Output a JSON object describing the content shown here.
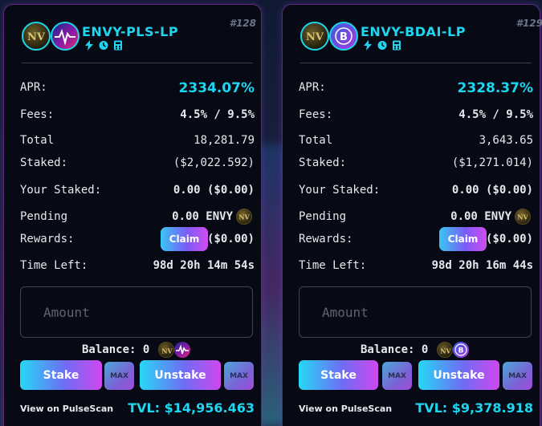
{
  "pools": [
    {
      "pool_number": "#128",
      "pair_name": "ENVY-PLS-LP",
      "token_b_icon": "pulse-wave-icon",
      "apr_label": "APR:",
      "apr_value": "2334.07%",
      "fees_label": "Fees:",
      "fees_value": "4.5% / 9.5%",
      "total_staked_label_1": "Total",
      "total_staked_label_2": "Staked:",
      "total_staked_amount": "18,281.79",
      "total_staked_usd": "($2,022.592)",
      "your_staked_label": "Your Staked:",
      "your_staked_value": "0.00 ($0.00)",
      "pending_label": "Pending",
      "rewards_label": "Rewards:",
      "pending_amount": "0.00 ENVY",
      "claim_label": "Claim",
      "rewards_usd": "($0.00)",
      "time_left_label": "Time Left:",
      "time_left_value": "98d 20h 14m 54s",
      "amount_placeholder": "Amount",
      "balance_label": "Balance: 0",
      "stake_label": "Stake",
      "unstake_label": "Unstake",
      "max_label": "MAX",
      "scan_link": "View on PulseScan",
      "tvl": "TVL: $14,956.463"
    },
    {
      "pool_number": "#129",
      "pair_name": "ENVY-BDAI-LP",
      "token_b_icon": "bdai-coin-icon",
      "apr_label": "APR:",
      "apr_value": "2328.37%",
      "fees_label": "Fees:",
      "fees_value": "4.5% / 9.5%",
      "total_staked_label_1": "Total",
      "total_staked_label_2": "Staked:",
      "total_staked_amount": "3,643.65",
      "total_staked_usd": "($1,271.014)",
      "your_staked_label": "Your Staked:",
      "your_staked_value": "0.00 ($0.00)",
      "pending_label": "Pending",
      "rewards_label": "Rewards:",
      "pending_amount": "0.00 ENVY",
      "claim_label": "Claim",
      "rewards_usd": "($0.00)",
      "time_left_label": "Time Left:",
      "time_left_value": "98d 20h 16m 44s",
      "amount_placeholder": "Amount",
      "balance_label": "Balance: 0",
      "stake_label": "Stake",
      "unstake_label": "Unstake",
      "max_label": "MAX",
      "scan_link": "View on PulseScan",
      "tvl": "TVL: $9,378.918"
    }
  ],
  "colors": {
    "accent_cyan": "#1ed6f0",
    "card_bg": "#070a14",
    "card_border": "#5a2a78",
    "button_gradient_start": "#26d8f6",
    "button_gradient_end": "#d047ee"
  }
}
